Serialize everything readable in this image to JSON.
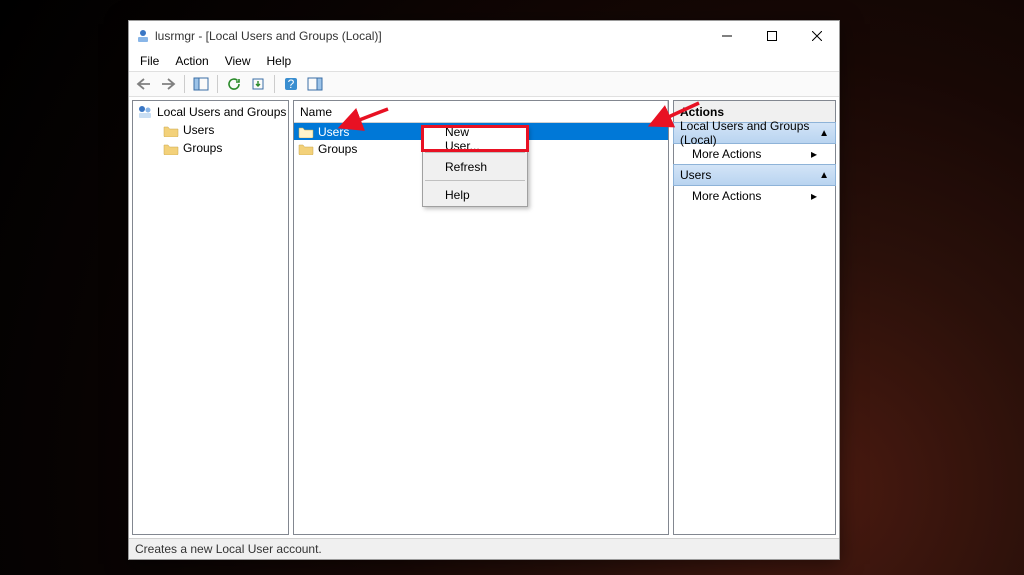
{
  "title": "lusrmgr - [Local Users and Groups (Local)]",
  "menubar": {
    "file": "File",
    "action": "Action",
    "view": "View",
    "help": "Help"
  },
  "tree": {
    "root": "Local Users and Groups (Local)",
    "children": [
      {
        "label": "Users"
      },
      {
        "label": "Groups"
      }
    ]
  },
  "list": {
    "column": "Name",
    "rows": [
      {
        "label": "Users",
        "selected": true
      },
      {
        "label": "Groups",
        "selected": false
      }
    ]
  },
  "context_menu": {
    "new_user": "New User...",
    "refresh": "Refresh",
    "help": "Help"
  },
  "actions": {
    "title": "Actions",
    "section1": {
      "header": "Local Users and Groups (Local)",
      "item": "More Actions"
    },
    "section2": {
      "header": "Users",
      "item": "More Actions"
    }
  },
  "statusbar": "Creates a new Local User account."
}
